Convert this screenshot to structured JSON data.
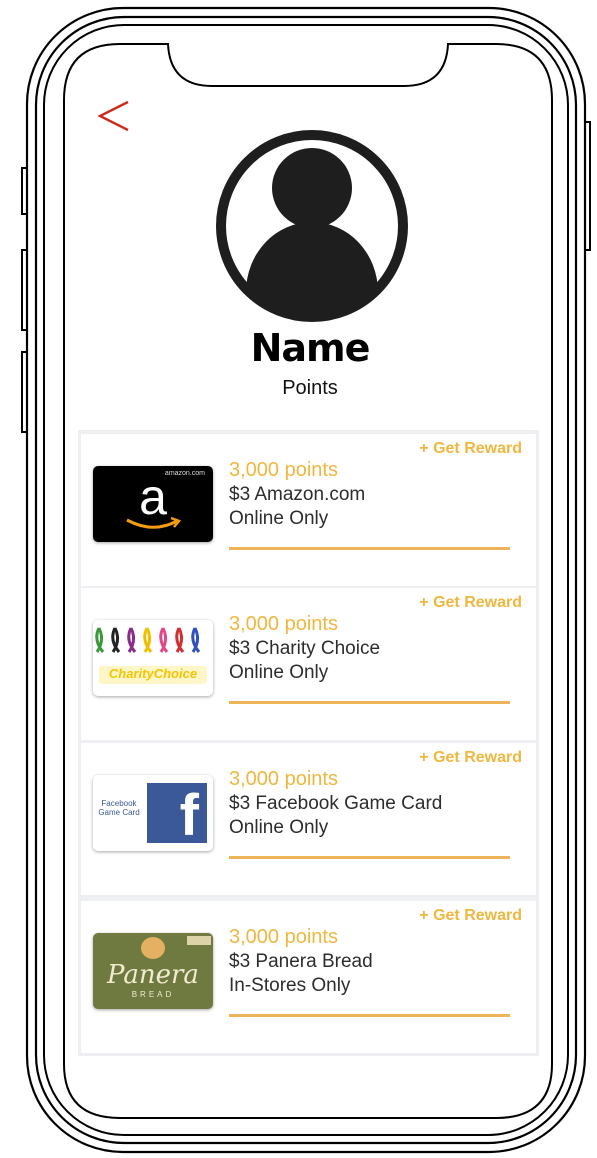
{
  "profile": {
    "name": "Name",
    "points_label": "Points"
  },
  "rewards": [
    {
      "points": "3,000 points",
      "title": "$3 Amazon.com",
      "availability": "Online Only",
      "action": "+ Get Reward",
      "card_brand": "amazon",
      "card_text": "amazon.com",
      "card_glyph": "a"
    },
    {
      "points": "3,000 points",
      "title": "$3 Charity Choice",
      "availability": "Online Only",
      "action": "+ Get Reward",
      "card_brand": "charity-choice",
      "card_text": "CharityChoice"
    },
    {
      "points": "3,000 points",
      "title": "$3 Facebook Game Card",
      "availability": "Online Only",
      "action": "+ Get Reward",
      "card_brand": "facebook",
      "card_text": "Facebook Game Card",
      "card_glyph": "f"
    },
    {
      "points": "3,000 points",
      "title": "$3 Panera Bread",
      "availability": "In-Stores Only",
      "action": "+ Get Reward",
      "card_brand": "panera",
      "card_text": "Panera",
      "card_subtext": "BREAD"
    }
  ],
  "icons": {
    "back": "chevron-left-icon",
    "avatar": "user-avatar-icon"
  },
  "colors": {
    "accent": "#f0b73f",
    "back_arrow": "#cc2a1f",
    "list_background": "#eeeff2",
    "amazon_card": "#000000",
    "facebook_blue": "#3b5998",
    "panera_green": "#6e7a3f"
  }
}
